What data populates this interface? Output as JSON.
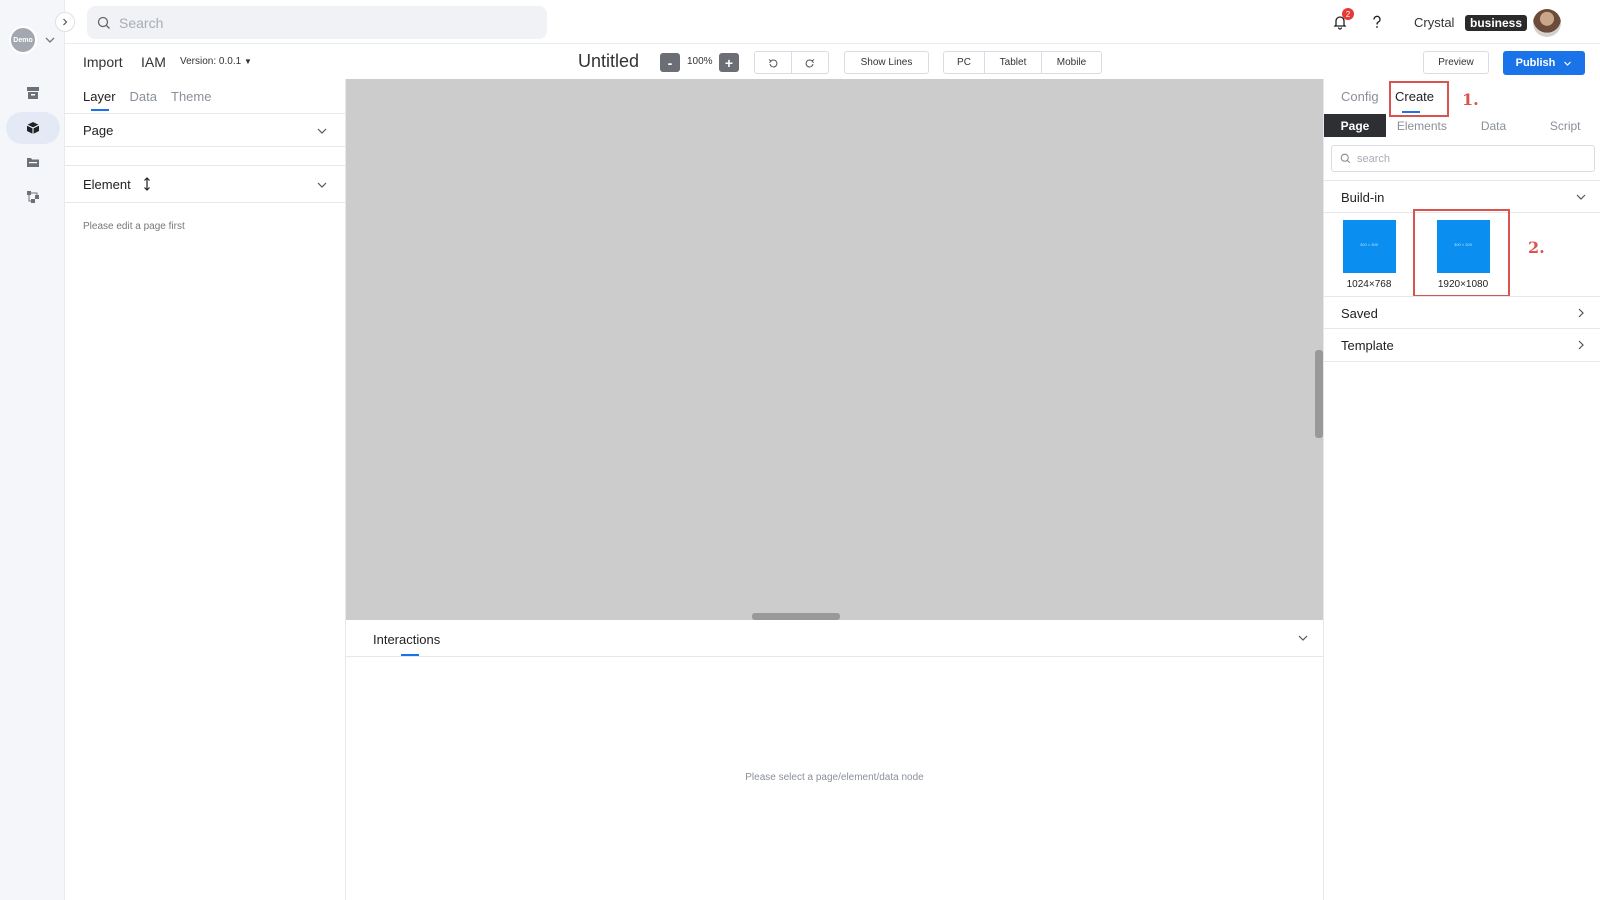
{
  "rail": {
    "workspace_avatar": "Demo"
  },
  "topbar": {
    "search_placeholder": "Search",
    "notification_count": "2",
    "username": "Crystal",
    "plan": "business"
  },
  "toolbar": {
    "import": "Import",
    "iam": "IAM",
    "version": "Version: 0.0.1",
    "title": "Untitled",
    "zoom": "100%",
    "zoom_out": "-",
    "zoom_in": "+",
    "show_lines": "Show Lines",
    "devices": [
      "PC",
      "Tablet",
      "Mobile"
    ],
    "preview": "Preview",
    "publish": "Publish"
  },
  "left_panel": {
    "tabs": [
      "Layer",
      "Data",
      "Theme"
    ],
    "page_section": "Page",
    "element_section": "Element",
    "note": "Please edit a page first"
  },
  "interactions": {
    "title": "Interactions",
    "note": "Please select a page/element/data node"
  },
  "right_panel": {
    "tabs": [
      "Config",
      "Create"
    ],
    "segments": [
      "Page",
      "Elements",
      "Data",
      "Script"
    ],
    "search_placeholder": "search",
    "buildin": "Build-in",
    "templates": [
      {
        "thumb_text": "300 × 300",
        "label": "1024×768"
      },
      {
        "thumb_text": "300 × 300",
        "label": "1920×1080"
      }
    ],
    "saved": "Saved",
    "template": "Template",
    "annotations": [
      "1.",
      "2."
    ]
  },
  "colors": {
    "accent": "#1a73e8",
    "highlight": "#d9534f",
    "canvas": "#cccccc"
  }
}
